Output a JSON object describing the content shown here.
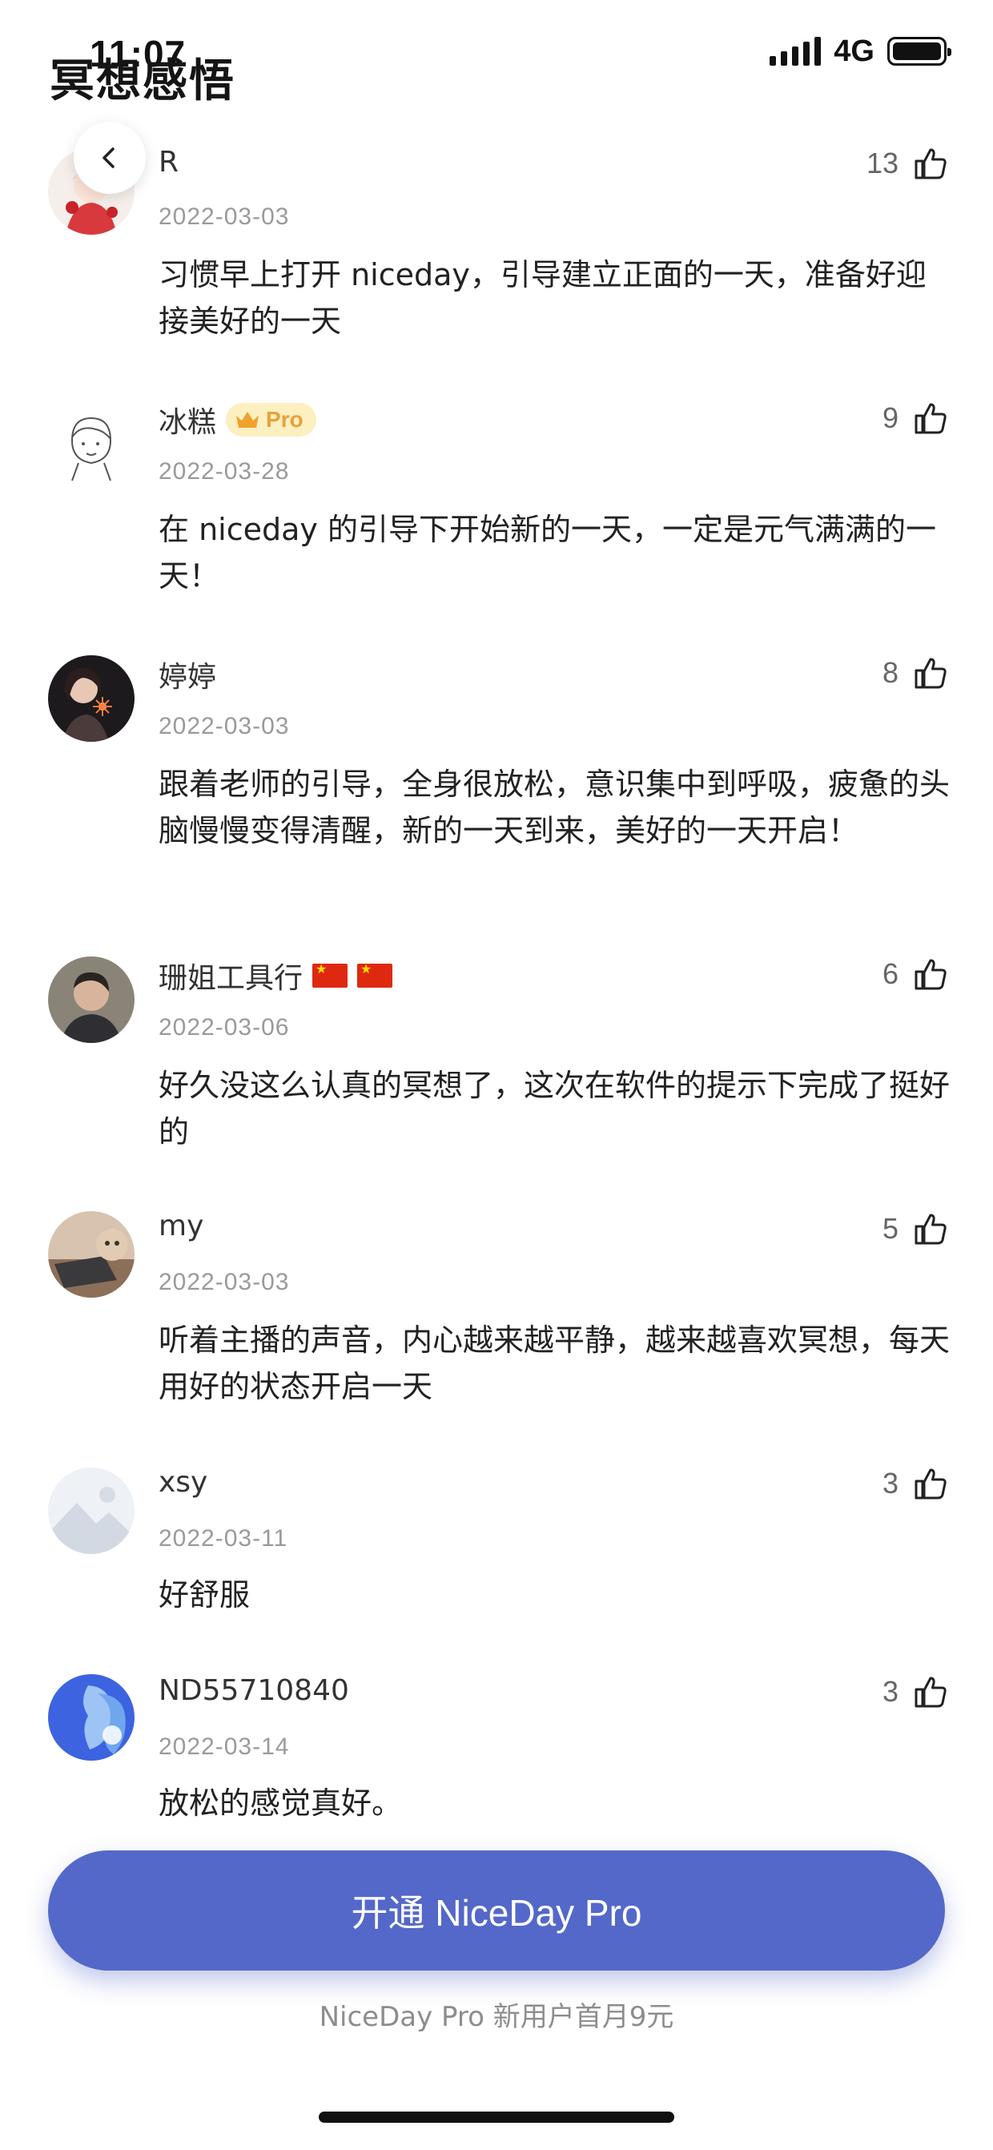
{
  "status_bar": {
    "time": "11:07",
    "network": "4G"
  },
  "header": {
    "title": "冥想感悟"
  },
  "comments": [
    {
      "user": "R",
      "badge": "",
      "flags": 0,
      "date": "2022-03-03",
      "text": "习惯早上打开 niceday，引导建立正面的一天，准备好迎接美好的一天",
      "likes": "13"
    },
    {
      "user": "冰糕",
      "badge": "Pro",
      "flags": 0,
      "date": "2022-03-28",
      "text": "在 niceday 的引导下开始新的一天，一定是元气满满的一天！",
      "likes": "9"
    },
    {
      "user": "婷婷",
      "badge": "",
      "flags": 0,
      "date": "2022-03-03",
      "text": "跟着老师的引导，全身很放松，意识集中到呼吸，疲惫的头脑慢慢变得清醒，新的一天到来，美好的一天开启！",
      "likes": "8"
    },
    {
      "user": "珊姐工具行",
      "badge": "",
      "flags": 2,
      "date": "2022-03-06",
      "text": "好久没这么认真的冥想了，这次在软件的提示下完成了挺好的",
      "likes": "6"
    },
    {
      "user": "my",
      "badge": "",
      "flags": 0,
      "date": "2022-03-03",
      "text": "听着主播的声音，内心越来越平静，越来越喜欢冥想，每天用好的状态开启一天",
      "likes": "5"
    },
    {
      "user": "xsy",
      "badge": "",
      "flags": 0,
      "date": "2022-03-11",
      "text": "好舒服",
      "likes": "3"
    },
    {
      "user": "ND55710840",
      "badge": "",
      "flags": 0,
      "date": "2022-03-14",
      "text": "放松的感觉真好。",
      "likes": "3"
    }
  ],
  "cta": {
    "label": "开通 NiceDay Pro",
    "subtitle": "NiceDay Pro 新用户首月9元"
  },
  "icons": {
    "back": "chevron-left-icon",
    "like": "thumbs-up-icon"
  },
  "colors": {
    "cta": "#5468c9",
    "pro_badge_bg": "#fcefc0",
    "pro_badge_text": "#e6a23c"
  }
}
